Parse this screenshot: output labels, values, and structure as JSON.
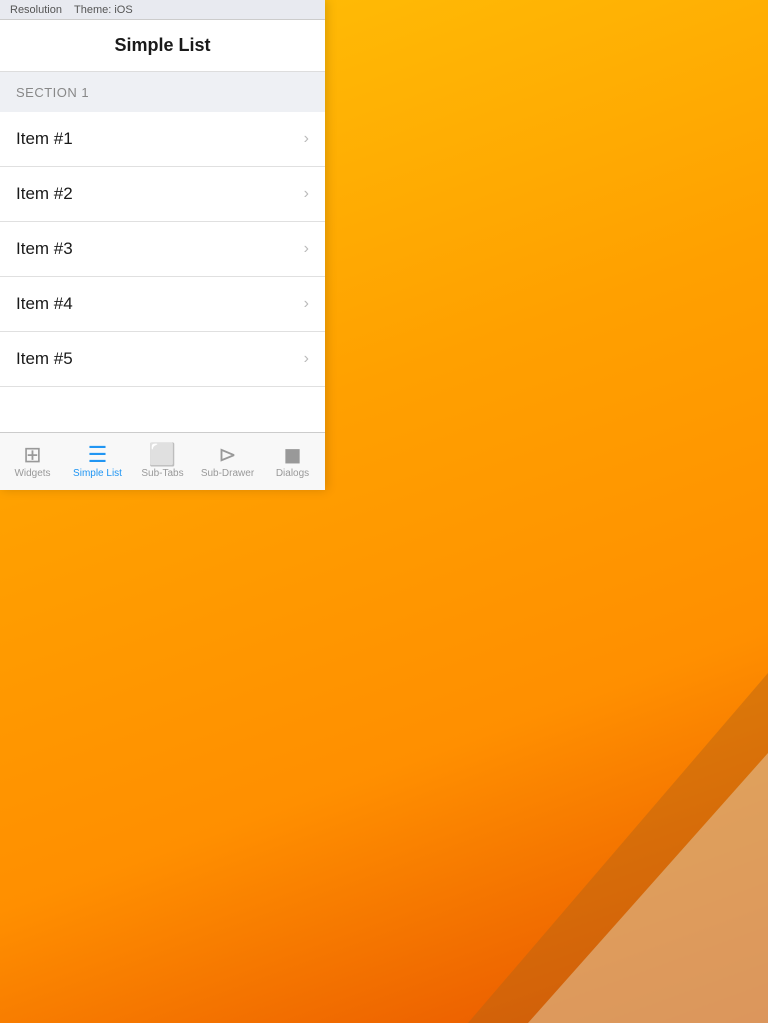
{
  "background": {
    "color_start": "#FFC107",
    "color_end": "#E65100"
  },
  "status_bar": {
    "resolution_label": "Resolution",
    "theme_label": "Theme: iOS"
  },
  "title_bar": {
    "title": "Simple List"
  },
  "section": {
    "label": "SECTION 1"
  },
  "list_items": [
    {
      "id": 1,
      "label": "Item #1"
    },
    {
      "id": 2,
      "label": "Item #2"
    },
    {
      "id": 3,
      "label": "Item #3"
    },
    {
      "id": 4,
      "label": "Item #4"
    },
    {
      "id": 5,
      "label": "Item #5"
    }
  ],
  "tabs": [
    {
      "id": "widgets",
      "label": "Widgets",
      "icon": "⊞",
      "active": false
    },
    {
      "id": "simple-list",
      "label": "Simple List",
      "icon": "≡",
      "active": true
    },
    {
      "id": "sub-tabs",
      "label": "Sub-Tabs",
      "icon": "▭",
      "active": false
    },
    {
      "id": "sub-drawer",
      "label": "Sub-Drawer",
      "icon": "▷",
      "active": false
    },
    {
      "id": "dialogs",
      "label": "Dialogs",
      "icon": "◼",
      "active": false
    }
  ]
}
